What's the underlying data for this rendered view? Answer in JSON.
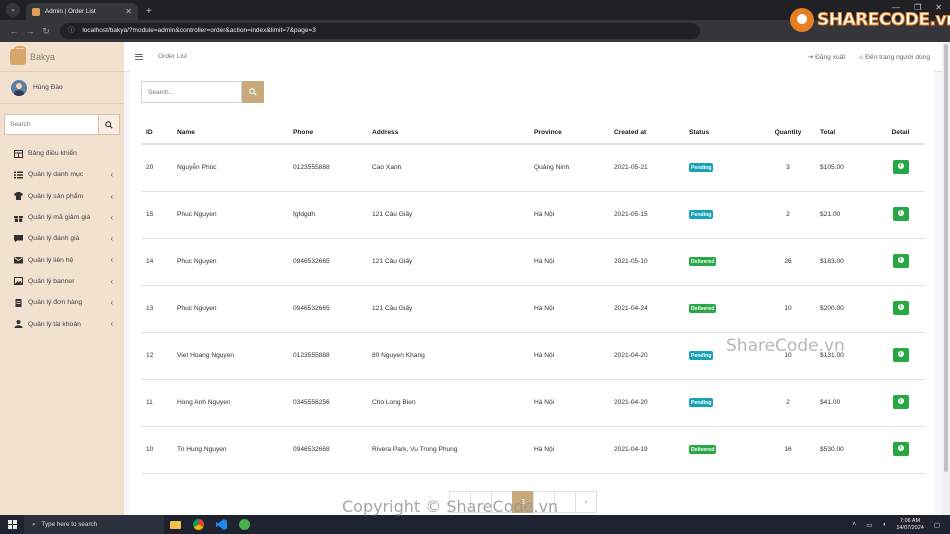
{
  "browser": {
    "tab_title": "Admin | Order List",
    "url": "localhost/bakya/?module=admin&controller=order&action=index&limit=7&page=3"
  },
  "sidebar": {
    "brand": "Bakya",
    "user_name": "Hùng Đào",
    "search_placeholder": "Search",
    "items": [
      {
        "label": "Bảng điều khiển",
        "icon": "table-icon",
        "has_children": false
      },
      {
        "label": "Quản lý danh mục",
        "icon": "list-icon",
        "has_children": true
      },
      {
        "label": "Quản lý sản phẩm",
        "icon": "shirt-icon",
        "has_children": true
      },
      {
        "label": "Quản lý mã giảm giá",
        "icon": "gift-icon",
        "has_children": true
      },
      {
        "label": "Quản lý đánh giá",
        "icon": "comment-icon",
        "has_children": true
      },
      {
        "label": "Quản lý liên hệ",
        "icon": "mail-icon",
        "has_children": true
      },
      {
        "label": "Quản lý banner",
        "icon": "image-icon",
        "has_children": true
      },
      {
        "label": "Quản lý đơn hàng",
        "icon": "file-icon",
        "has_children": true
      },
      {
        "label": "Quản lý tài khoản",
        "icon": "user-icon",
        "has_children": true
      }
    ]
  },
  "header": {
    "breadcrumb": "Order List",
    "logout": "Đăng xuất",
    "home": "Đến trang người dùng"
  },
  "main": {
    "search_placeholder": "Search...",
    "columns": [
      "ID",
      "Name",
      "Phone",
      "Address",
      "Province",
      "Created at",
      "Status",
      "Quantity",
      "Total",
      "Detail"
    ],
    "rows": [
      {
        "id": "20",
        "name": "Nguyễn Phúc",
        "phone": "0123555888",
        "address": "Cao Xanh",
        "province": "Quảng Ninh",
        "created": "2021-05-21",
        "status": "Pending",
        "qty": "3",
        "total": "$105.00"
      },
      {
        "id": "15",
        "name": "Phuc Nguyen",
        "phone": "fgfdgdh",
        "address": "121 Cầu Giấy",
        "province": "Hà Nội",
        "created": "2021-05-15",
        "status": "Pending",
        "qty": "2",
        "total": "$21.00"
      },
      {
        "id": "14",
        "name": "Phuc Nguyen",
        "phone": "0946532665",
        "address": "121 Cầu Giấy",
        "province": "Hà Nội",
        "created": "2021-05-10",
        "status": "Delivered",
        "qty": "26",
        "total": "$183.00"
      },
      {
        "id": "13",
        "name": "Phuc Nguyen",
        "phone": "0946532665",
        "address": "121 Cầu Giấy",
        "province": "Hà Nội",
        "created": "2021-04-24",
        "status": "Delivered",
        "qty": "10",
        "total": "$200.00"
      },
      {
        "id": "12",
        "name": "Viet Hoang Nguyen",
        "phone": "0123555888",
        "address": "80 Nguyen Khang",
        "province": "Hà Nội",
        "created": "2021-04-20",
        "status": "Pending",
        "qty": "10",
        "total": "$131.00"
      },
      {
        "id": "11",
        "name": "Hong Anh Nguyen",
        "phone": "0345556256",
        "address": "Cho Long Bien",
        "province": "Hà Nội",
        "created": "2021-04-20",
        "status": "Pending",
        "qty": "2",
        "total": "$41.00"
      },
      {
        "id": "10",
        "name": "Tri Hung Nguyen",
        "phone": "0946532668",
        "address": "Rivera Park, Vu Trong Phung",
        "province": "Hà Nội",
        "created": "2021-04-19",
        "status": "Delivered",
        "qty": "16",
        "total": "$530.00"
      }
    ],
    "pagination": {
      "active": "3",
      "next": "›"
    }
  },
  "status_colors": {
    "Pending": "#17a2b8",
    "Delivered": "#28a745"
  },
  "accent_color": "#c8a97c",
  "taskbar": {
    "search_placeholder": "Type here to search",
    "time": "7:06 AM",
    "date": "14/07/2024"
  },
  "watermarks": {
    "logo": "SHARECODE.vn",
    "center": "ShareCode.vn",
    "footer": "Copyright © ShareCode.vn"
  }
}
